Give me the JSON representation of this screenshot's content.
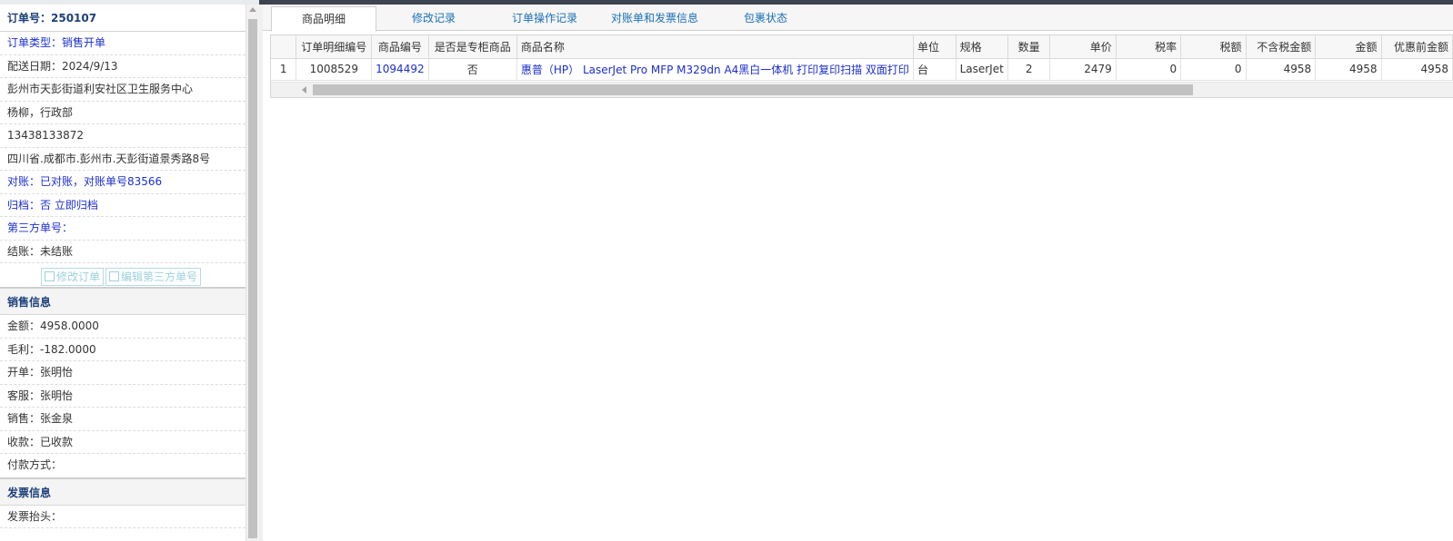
{
  "order": {
    "header": "订单号：250107",
    "type": {
      "label": "订单类型：",
      "value": "销售开单"
    },
    "delivery_date": "配送日期：2024/9/13",
    "customer": "彭州市天彭街道利安社区卫生服务中心",
    "contact": "杨柳，行政部",
    "phone": "13438133872",
    "address": "四川省.成都市.彭州市.天彭街道景秀路8号",
    "reconcile": "对账：已对账，对账单号83566",
    "archive": {
      "label": "归档：",
      "value": "否",
      "action": "立即归档"
    },
    "third_party": "第三方单号：",
    "settlement": "结账：未结账",
    "buttons": {
      "edit_order": "修改订单",
      "edit_third": "编辑第三方单号"
    }
  },
  "sales": {
    "title": "销售信息",
    "amount": "金额：4958.0000",
    "gross_profit": "毛利：-182.0000",
    "opener": "开单：张明怡",
    "service": "客服：张明怡",
    "seller": "销售：张金泉",
    "payment_received": "收款：已收款",
    "payment_method": "付款方式："
  },
  "invoice": {
    "title": "发票信息",
    "header": "发票抬头："
  },
  "tabs": [
    {
      "label": "商品明细",
      "active": true
    },
    {
      "label": "修改记录",
      "active": false
    },
    {
      "label": "订单操作记录",
      "active": false
    },
    {
      "label": "对账单和发票信息",
      "active": false
    },
    {
      "label": "包裹状态",
      "active": false
    }
  ],
  "table": {
    "columns": [
      "",
      "订单明细编号",
      "商品编号",
      "是否是专柜商品",
      "商品名称",
      "单位",
      "规格",
      "数量",
      "单价",
      "税率",
      "税额",
      "不含税金额",
      "金额",
      "优惠前金额"
    ],
    "rows": [
      {
        "index": "1",
        "detail_no": "1008529",
        "product_no": "1094492",
        "counter": "否",
        "name": "惠普（HP） LaserJet Pro MFP M329dn A4黑白一体机 打印复印扫描 双面打印",
        "unit": "台",
        "spec": "LaserJet",
        "qty": "2",
        "price": "2479",
        "tax_rate": "0",
        "tax": "0",
        "net_amount": "4958",
        "amount": "4958",
        "pre_discount": "4958"
      }
    ]
  }
}
